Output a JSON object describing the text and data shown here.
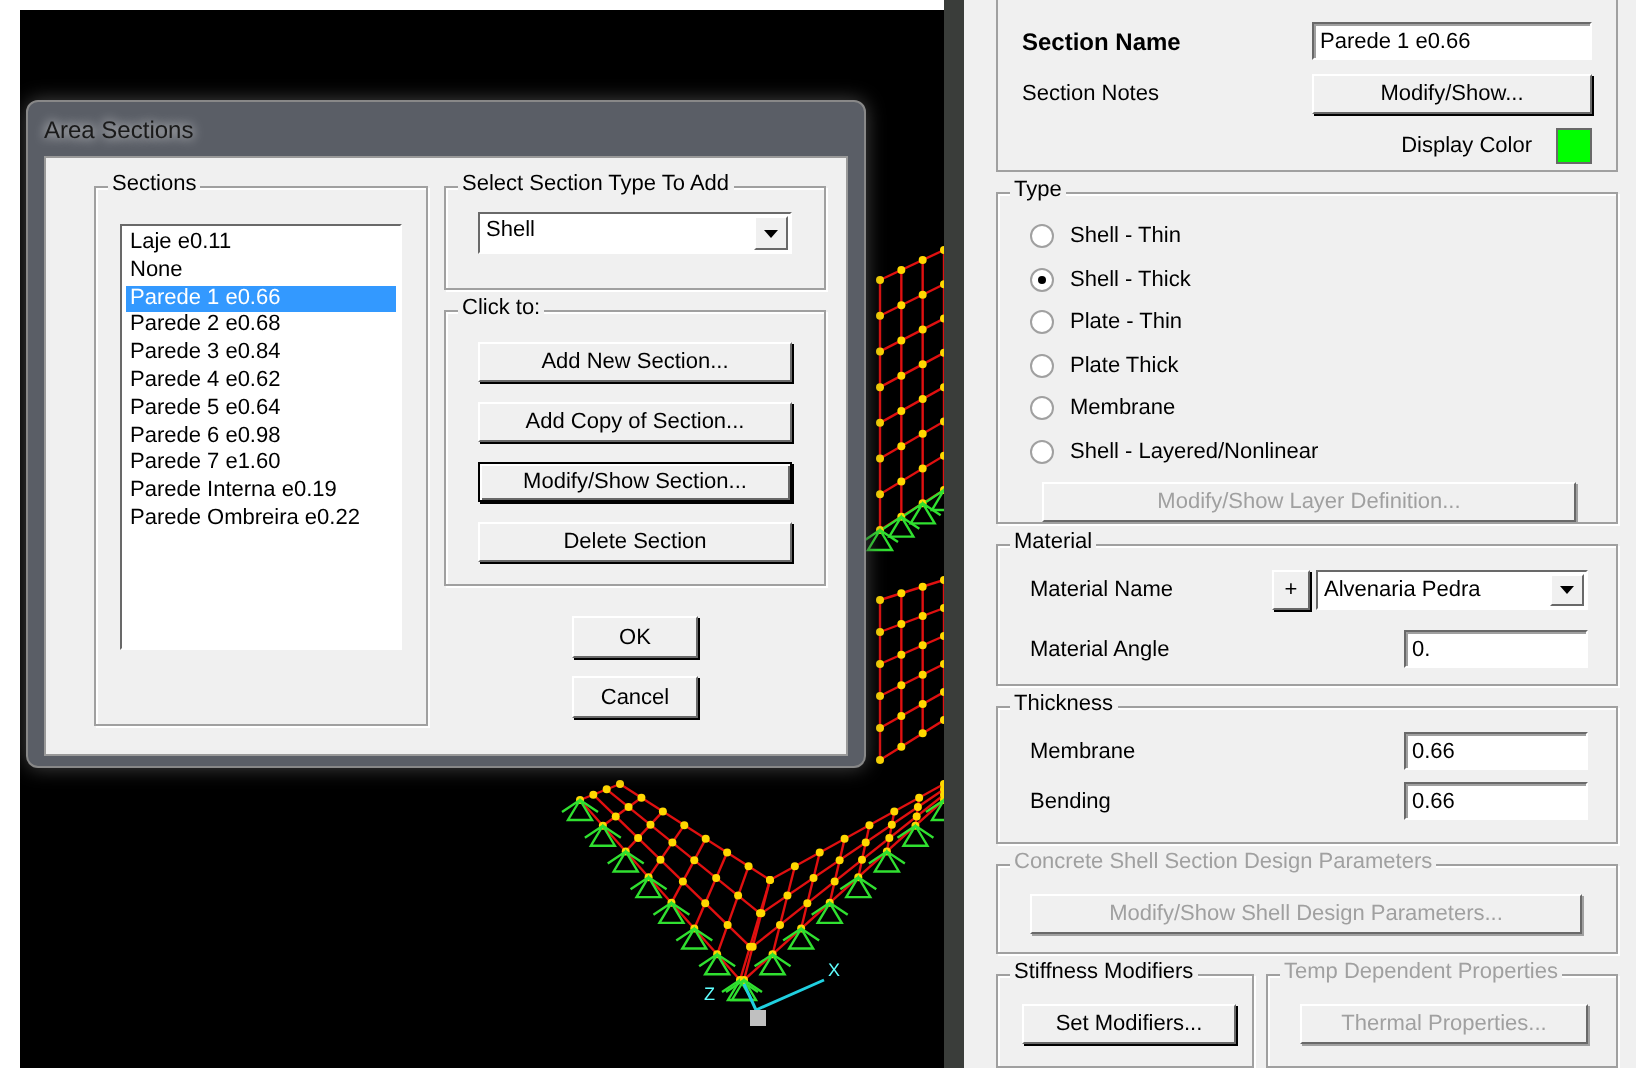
{
  "model_view": {
    "axis_labels": [
      "Z",
      "X"
    ]
  },
  "dialog": {
    "title": "Area Sections",
    "sections": {
      "label": "Sections",
      "items": [
        {
          "label": "Laje e0.11",
          "selected": false
        },
        {
          "label": "None",
          "selected": false
        },
        {
          "label": "Parede 1 e0.66",
          "selected": true
        },
        {
          "label": "Parede 2 e0.68",
          "selected": false
        },
        {
          "label": "Parede 3 e0.84",
          "selected": false
        },
        {
          "label": "Parede 4 e0.62",
          "selected": false
        },
        {
          "label": "Parede 5 e0.64",
          "selected": false
        },
        {
          "label": "Parede 6 e0.98",
          "selected": false
        },
        {
          "label": "Parede 7 e1.60",
          "selected": false
        },
        {
          "label": "Parede Interna e0.19",
          "selected": false
        },
        {
          "label": "Parede Ombreira e0.22",
          "selected": false
        }
      ]
    },
    "section_type": {
      "label": "Select Section Type To Add",
      "value": "Shell"
    },
    "click_to": {
      "label": "Click to:",
      "buttons": [
        {
          "label": "Add New Section...",
          "focused": false
        },
        {
          "label": "Add Copy of Section...",
          "focused": false
        },
        {
          "label": "Modify/Show Section...",
          "focused": true
        },
        {
          "label": "Delete Section",
          "focused": false
        }
      ]
    },
    "ok": "OK",
    "cancel": "Cancel"
  },
  "panel": {
    "section_name": {
      "label": "Section Name",
      "value": "Parede 1 e0.66"
    },
    "section_notes": {
      "label": "Section Notes",
      "button": "Modify/Show..."
    },
    "display_color": {
      "label": "Display Color",
      "color": "#00ff00"
    },
    "type": {
      "label": "Type",
      "options": [
        {
          "label": "Shell - Thin",
          "selected": false
        },
        {
          "label": "Shell - Thick",
          "selected": true
        },
        {
          "label": "Plate - Thin",
          "selected": false
        },
        {
          "label": "Plate Thick",
          "selected": false
        },
        {
          "label": "Membrane",
          "selected": false
        },
        {
          "label": "Shell - Layered/Nonlinear",
          "selected": false
        }
      ],
      "button": {
        "label": "Modify/Show Layer Definition...",
        "disabled": true
      }
    },
    "material": {
      "label": "Material",
      "name_label": "Material Name",
      "add": "+",
      "name_value": "Alvenaria Pedra",
      "angle_label": "Material Angle",
      "angle_value": "0."
    },
    "thickness": {
      "label": "Thickness",
      "membrane_label": "Membrane",
      "membrane_value": "0.66",
      "bending_label": "Bending",
      "bending_value": "0.66"
    },
    "concrete": {
      "label": "Concrete Shell Section Design Parameters",
      "button": "Modify/Show Shell Design Parameters...",
      "disabled": true
    },
    "stiffness": {
      "label": "Stiffness Modifiers",
      "button": "Set Modifiers...",
      "disabled": false
    },
    "temp": {
      "label": "Temp Dependent Properties",
      "button": "Thermal Properties...",
      "disabled": true
    }
  }
}
